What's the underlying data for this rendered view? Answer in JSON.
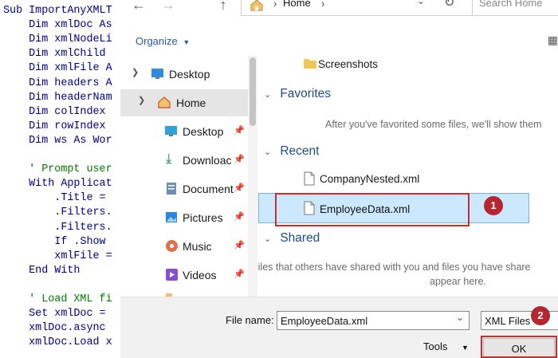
{
  "code": {
    "lines": [
      "Sub ImportAnyXMLT",
      "    Dim xmlDoc As",
      "    Dim xmlNodeLi",
      "    Dim xmlChild",
      "    Dim xmlFile A",
      "    Dim headers A",
      "    Dim headerNam",
      "    Dim colIndex",
      "    Dim rowIndex",
      "    Dim ws As Wor",
      "",
      "    ' Prompt user",
      "    With Applicat",
      "        .Title =",
      "        .Filters.",
      "        .Filters.",
      "        If .Show",
      "        xmlFile =",
      "    End With",
      "",
      "    ' Load XML fi",
      "    Set xmlDoc =",
      "    xmlDoc.async",
      "    xmlDoc.Load x"
    ]
  },
  "address": {
    "path": "Home",
    "search_placeholder": "Search Home"
  },
  "toolbar": {
    "organize": "Organize"
  },
  "nav": {
    "items": [
      {
        "label": "Desktop",
        "icon": "desktop-icon"
      },
      {
        "label": "Home",
        "icon": "home-icon"
      },
      {
        "label": "Desktop",
        "icon": "desktop-icon"
      },
      {
        "label": "Downloac",
        "icon": "download-icon"
      },
      {
        "label": "Document",
        "icon": "documents-icon"
      },
      {
        "label": "Pictures",
        "icon": "pictures-icon"
      },
      {
        "label": "Music",
        "icon": "music-icon"
      },
      {
        "label": "Videos",
        "icon": "videos-icon"
      }
    ]
  },
  "content": {
    "top_folder": "Screenshots",
    "favorites_title": "Favorites",
    "favorites_msg": "After you've favorited some files, we'll show them",
    "recent_title": "Recent",
    "recent_files": [
      "CompanyNested.xml",
      "EmployeeData.xml"
    ],
    "shared_title": "Shared",
    "shared_msg_1": "Files that others have shared with you and files you have share",
    "shared_msg_2": "appear here."
  },
  "bottom": {
    "file_name_label": "File name:",
    "file_name_value": "EmployeeData.xml",
    "filter_value": "XML Files",
    "tools_label": "Tools",
    "ok_label": "OK"
  },
  "badges": [
    "1",
    "2"
  ],
  "colors": {
    "accent": "#cce8ff",
    "highlight": "#d02b2b",
    "badge": "#b5262d"
  }
}
